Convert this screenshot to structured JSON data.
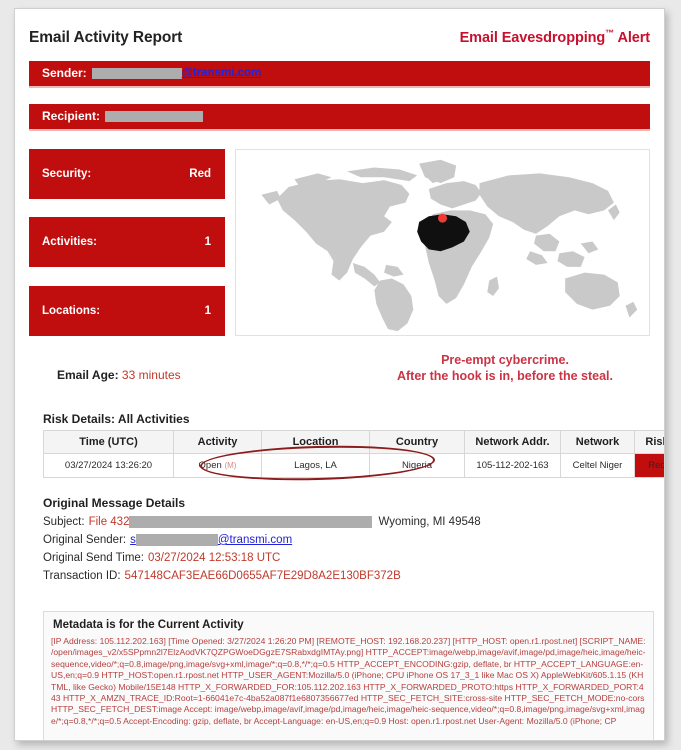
{
  "header": {
    "report_title": "Email Activity Report",
    "alert_title_main": "Email Eavesdropping",
    "alert_title_tm": "™",
    "alert_title_suffix": " Alert"
  },
  "addresses": {
    "sender_label": "Sender:",
    "sender_domain": "@transmi.com",
    "recipient_label": "Recipient:",
    "recipient_value": ""
  },
  "stats": [
    {
      "label": "Security:",
      "value": "Red"
    },
    {
      "label": "Activities:",
      "value": "1"
    },
    {
      "label": "Locations:",
      "value": "1"
    }
  ],
  "map": {
    "highlight_country": "Nigeria",
    "marker": "location-pin",
    "land_color": "#c9c9c9",
    "highlight_color": "#101010",
    "marker_color": "#ef3b36"
  },
  "tagline": {
    "line1": "Pre-empt cybercrime.",
    "line2": "After the hook is in, before the steal."
  },
  "email_age": {
    "label": "Email Age:",
    "value": "33 minutes"
  },
  "risk_section": {
    "heading": "Risk Details: All Activities",
    "columns": [
      "Time (UTC)",
      "Activity",
      "Location",
      "Country",
      "Network Addr.",
      "Network",
      "Risk"
    ],
    "rows": [
      {
        "time": "03/27/2024 13:26:20",
        "activity": "Open",
        "activity_flag": "(M)",
        "location": "Lagos, LA",
        "country": "Nigeria",
        "network_addr": "105-112-202-163",
        "network": "Celtel Niger",
        "risk": "Red"
      }
    ]
  },
  "original_message": {
    "title": "Original Message Details",
    "subject_label": "Subject:",
    "subject_value": "File 432",
    "subject_tail": "Wyoming, MI 49548",
    "sender_label": "Original Sender:",
    "sender_prefix": "s",
    "sender_domain": "@transmi.com",
    "send_time_label": "Original Send Time:",
    "send_time_value": "03/27/2024 12:53:18 UTC",
    "transaction_label": "Transaction ID:",
    "transaction_value": "547148CAF3EAE66D0655AF7E29D8A2E130BF372B"
  },
  "metadata": {
    "title": "Metadata is for the Current Activity",
    "body": "[IP Address: 105.112.202.163] [Time Opened: 3/27/2024 1:26:20 PM] [REMOTE_HOST: 192.168.20.237] [HTTP_HOST: open.r1.rpost.net] [SCRIPT_NAME: /open/images_v2/x5SPpmn2l7ElzAodVK7QZPGWoeDGgzE7SRabxdgIMTAy.png] HTTP_ACCEPT:image/webp,image/avif,image/pd,image/heic,image/heic-sequence,video/*;q=0.8,image/png,image/svg+xml,image/*;q=0.8,*/*;q=0.5 HTTP_ACCEPT_ENCODING:gzip, deflate, br HTTP_ACCEPT_LANGUAGE:en-US,en;q=0.9 HTTP_HOST:open.r1.rpost.net HTTP_USER_AGENT:Mozilla/5.0 (iPhone; CPU iPhone OS 17_3_1 like Mac OS X) AppleWebKit/605.1.15 (KHTML, like Gecko) Mobile/15E148 HTTP_X_FORWARDED_FOR:105.112.202.163 HTTP_X_FORWARDED_PROTO:https HTTP_X_FORWARDED_PORT:443 HTTP_X_AMZN_TRACE_ID:Root=1-66041e7c-4ba52a087f1e6807356677ed HTTP_SEC_FETCH_SITE:cross-site HTTP_SEC_FETCH_MODE:no-cors HTTP_SEC_FETCH_DEST:image Accept: image/webp,image/avif,image/pd,image/heic,image/heic-sequence,video/*;q=0.8,image/png,image/svg+xml,image/*;q=0.8,*/*;q=0.5 Accept-Encoding: gzip, deflate, br Accept-Language: en-US,en;q=0.9 Host: open.r1.rpost.net User-Agent: Mozilla/5.0 (iPhone; CP"
  }
}
